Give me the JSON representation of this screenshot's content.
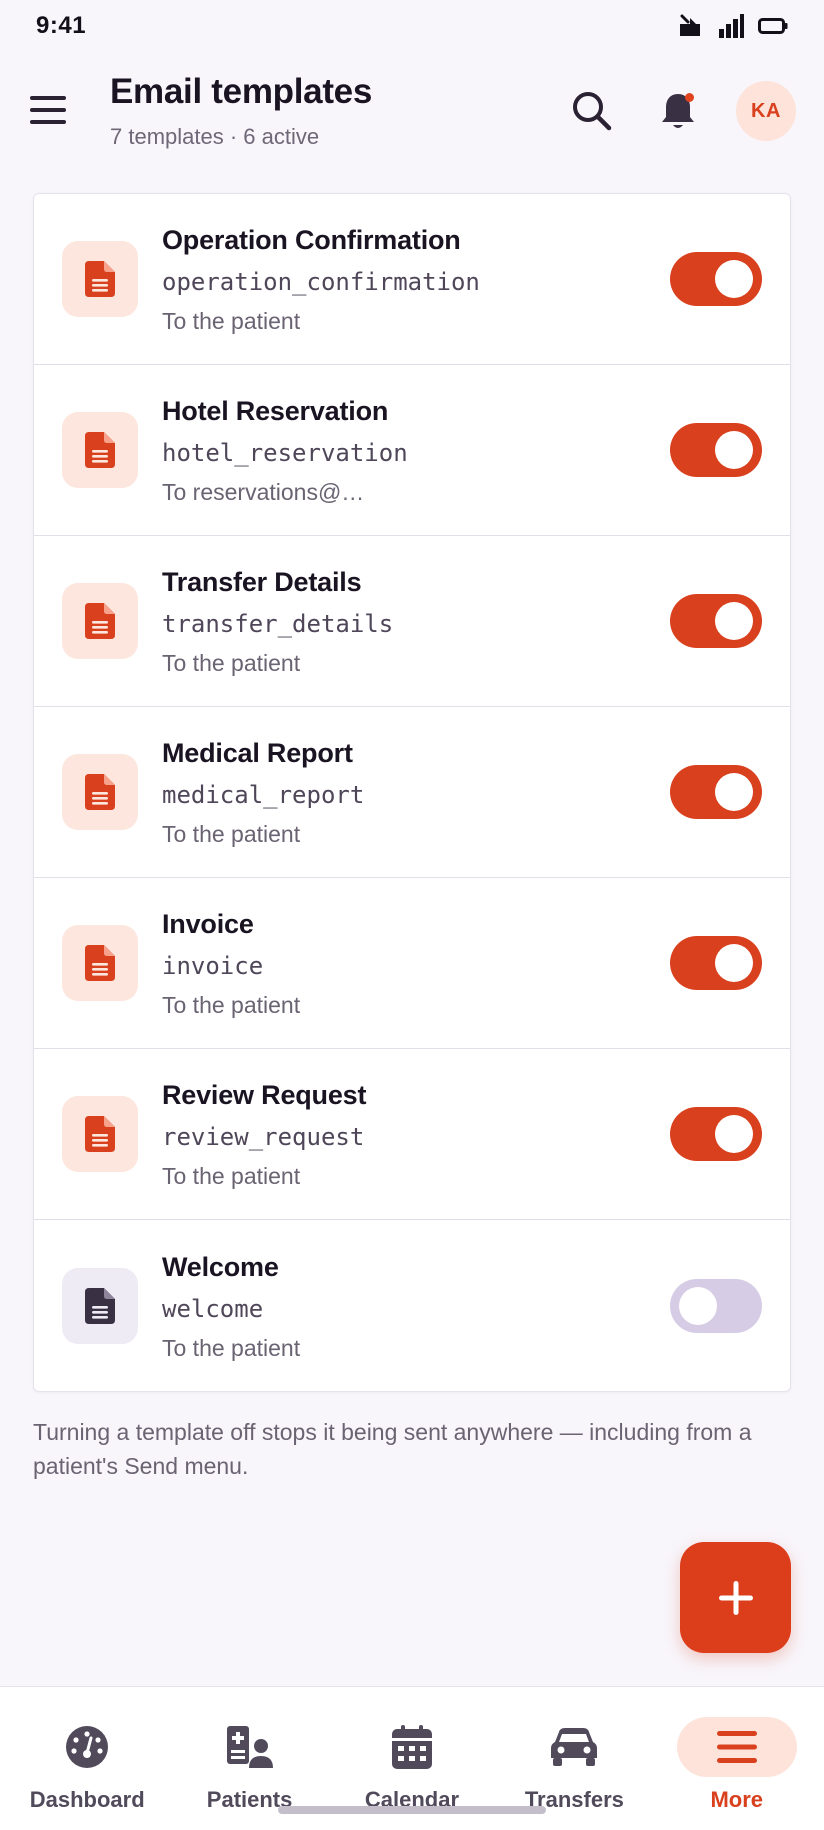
{
  "status_bar": {
    "time": "9:41"
  },
  "header": {
    "title": "Email templates",
    "subtitle": "7 templates · 6 active",
    "avatar_initials": "KA",
    "has_notification": true
  },
  "templates": [
    {
      "name": "Operation Confirmation",
      "key": "operation_confirmation",
      "recipient": "To the patient",
      "active": true,
      "icon": "document-icon"
    },
    {
      "name": "Hotel Reservation",
      "key": "hotel_reservation",
      "recipient": "To reservations@…",
      "active": true,
      "icon": "document-icon"
    },
    {
      "name": "Transfer Details",
      "key": "transfer_details",
      "recipient": "To the patient",
      "active": true,
      "icon": "document-icon"
    },
    {
      "name": "Medical Report",
      "key": "medical_report",
      "recipient": "To the patient",
      "active": true,
      "icon": "document-icon"
    },
    {
      "name": "Invoice",
      "key": "invoice",
      "recipient": "To the patient",
      "active": true,
      "icon": "document-icon"
    },
    {
      "name": "Review Request",
      "key": "review_request",
      "recipient": "To the patient",
      "active": true,
      "icon": "document-icon"
    },
    {
      "name": "Welcome",
      "key": "welcome",
      "recipient": "To the patient",
      "active": false,
      "icon": "document-icon"
    }
  ],
  "footnote": "Turning a template off stops it being sent anywhere — including from a patient's Send menu.",
  "nav": {
    "items": [
      {
        "label": "Dashboard",
        "icon": "dashboard-gauge-icon",
        "active": false
      },
      {
        "label": "Patients",
        "icon": "patients-icon",
        "active": false
      },
      {
        "label": "Calendar",
        "icon": "calendar-icon",
        "active": false
      },
      {
        "label": "Transfers",
        "icon": "car-icon",
        "active": false
      },
      {
        "label": "More",
        "icon": "menu-icon",
        "active": true
      }
    ]
  },
  "colors": {
    "accent": "#d9401e",
    "accent_soft": "#fde3da",
    "toggle_off": "#d6cce6",
    "text_primary": "#1a1422",
    "text_secondary": "#6a6372",
    "background": "#f8f6fb"
  }
}
